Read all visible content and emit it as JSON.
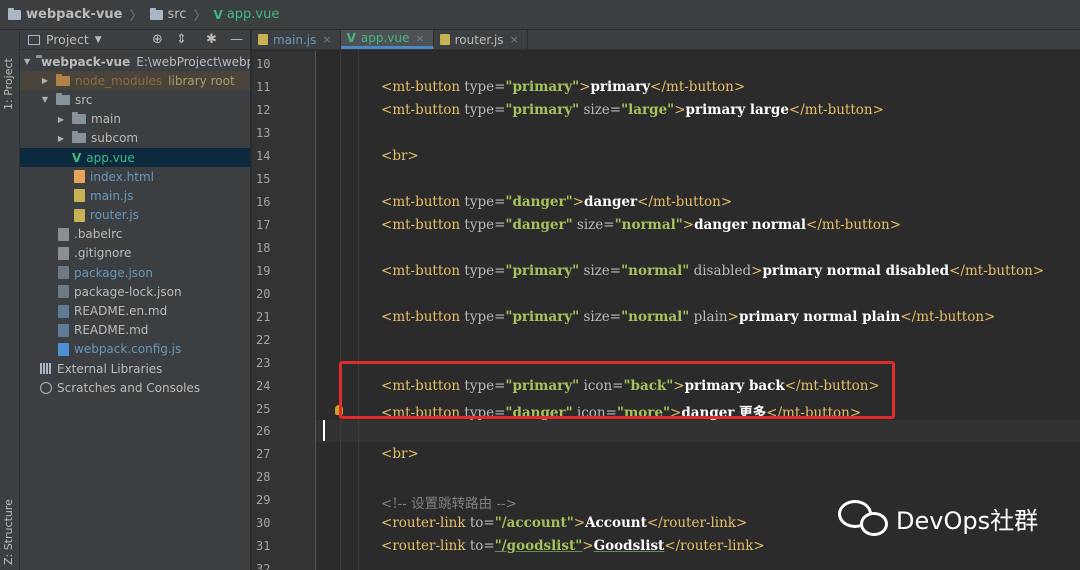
{
  "breadcrumb": {
    "project": "webpack-vue",
    "folder": "src",
    "file": "app.vue"
  },
  "left_strip": {
    "project_tab": "1: Project",
    "structure_tab": "Z: Structure"
  },
  "project_panel": {
    "title": "Project",
    "tree": [
      {
        "label": "webpack-vue",
        "extra": "E:\\webProject\\webpa",
        "type": "root"
      },
      {
        "label": "node_modules",
        "extra": "library root",
        "type": "folder-collapsed"
      },
      {
        "label": "src",
        "type": "folder-open"
      },
      {
        "label": "main",
        "type": "folder-collapsed"
      },
      {
        "label": "subcom",
        "type": "folder-collapsed"
      },
      {
        "label": "app.vue",
        "type": "vue"
      },
      {
        "label": "index.html",
        "type": "html"
      },
      {
        "label": "main.js",
        "type": "js"
      },
      {
        "label": "router.js",
        "type": "js"
      },
      {
        "label": ".babelrc",
        "type": "txt"
      },
      {
        "label": ".gitignore",
        "type": "txt"
      },
      {
        "label": "package.json",
        "type": "json"
      },
      {
        "label": "package-lock.json",
        "type": "json"
      },
      {
        "label": "README.en.md",
        "type": "md"
      },
      {
        "label": "README.md",
        "type": "md"
      },
      {
        "label": "webpack.config.js",
        "type": "webpack"
      },
      {
        "label": "External Libraries",
        "type": "lib"
      },
      {
        "label": "Scratches and Consoles",
        "type": "scratch"
      }
    ]
  },
  "tabs": [
    {
      "label": "main.js",
      "active": false
    },
    {
      "label": "app.vue",
      "active": true
    },
    {
      "label": "router.js",
      "active": false
    }
  ],
  "editor": {
    "line_numbers": [
      "10",
      "11",
      "12",
      "13",
      "14",
      "15",
      "16",
      "17",
      "18",
      "19",
      "20",
      "21",
      "22",
      "23",
      "24",
      "25",
      "26",
      "27",
      "28",
      "29",
      "30",
      "31",
      "32"
    ],
    "code": {
      "l11": {
        "tag": "mt-button",
        "type_attr": "type=",
        "type_val": "\"primary\"",
        "text": "primary"
      },
      "l12": {
        "tag": "mt-button",
        "type_attr": "type=",
        "type_val": "\"primary\"",
        "size_attr": "size=",
        "size_val": "\"large\"",
        "text": "primary large"
      },
      "l14": {
        "tag": "br"
      },
      "l16": {
        "tag": "mt-button",
        "type_attr": "type=",
        "type_val": "\"danger\"",
        "text": "danger"
      },
      "l17": {
        "tag": "mt-button",
        "type_attr": "type=",
        "type_val": "\"danger\"",
        "size_attr": "size=",
        "size_val": "\"normal\"",
        "text": "danger normal"
      },
      "l19": {
        "tag": "mt-button",
        "type_attr": "type=",
        "type_val": "\"primary\"",
        "size_attr": "size=",
        "size_val": "\"normal\"",
        "flag": "disabled",
        "text": "primary normal disabled"
      },
      "l21": {
        "tag": "mt-button",
        "type_attr": "type=",
        "type_val": "\"primary\"",
        "size_attr": "size=",
        "size_val": "\"normal\"",
        "flag": "plain",
        "text": "primary normal plain"
      },
      "l24": {
        "tag": "mt-button",
        "type_attr": "type=",
        "type_val": "\"primary\"",
        "icon_attr": "icon=",
        "icon_val": "\"back\"",
        "text": "primary back"
      },
      "l25": {
        "tag": "mt-button",
        "type_attr": "type=",
        "type_val": "\"danger\"",
        "icon_attr": "icon=",
        "icon_val": "\"more\"",
        "text": "danger 更多"
      },
      "l27": {
        "tag": "br"
      },
      "l29": {
        "comment": "<!-- 设置跳转路由 -->"
      },
      "l30": {
        "tag": "router-link",
        "to_attr": "to=",
        "to_val": "\"/account\"",
        "text": "Account"
      },
      "l31": {
        "tag": "router-link",
        "to_attr": "to=",
        "to_val": "\"/goodslist\"",
        "text": "Goodslist"
      }
    }
  },
  "watermark": {
    "text": "DevOps社群"
  },
  "colors": {
    "annotation": "#e02c2c",
    "tag": "#e8bf6a",
    "string": "#a5c25c",
    "vue": "#41b883"
  }
}
